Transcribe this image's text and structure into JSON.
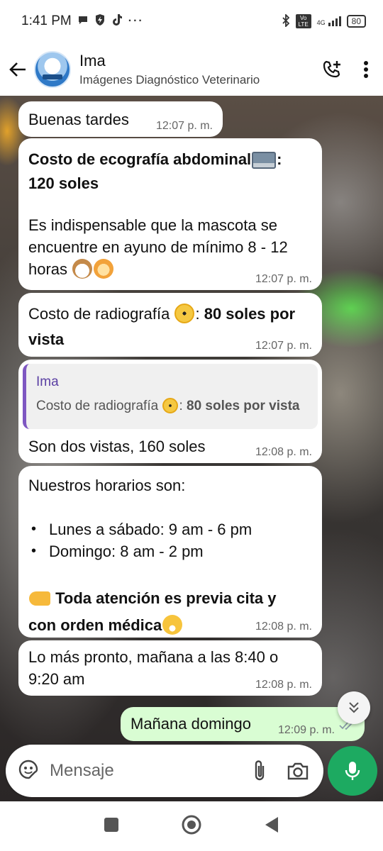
{
  "status_bar": {
    "time": "1:41 PM",
    "icons_left": [
      "chat-bubble-icon",
      "shield-bolt-icon",
      "tiktok-icon",
      "more-dots-icon"
    ],
    "icons_right": [
      "bluetooth-icon",
      "volte-icon",
      "4g-signal-icon"
    ],
    "network": "4G",
    "volte": "Vo LTE",
    "battery": "80"
  },
  "header": {
    "name": "Ima",
    "subtitle": "Imágenes Diagnóstico Veterinario"
  },
  "messages": [
    {
      "text": "Buenas tardes",
      "time": "12:07 p. m."
    },
    {
      "line1": "Costo de ecografía abdominal",
      "line1_tail": ":",
      "line2": "120 soles",
      "para": "Es indispensable que la mascota se encuentre en ayuno de mínimo 8 - 12 horas",
      "time": "12:07 p. m."
    },
    {
      "normal": "Costo de radiografía ",
      "colon": ": ",
      "bold": "80 soles por vista",
      "time": "12:07 p. m."
    },
    {
      "quote_author": "Ima",
      "quote_normal": "Costo de radiografía ",
      "quote_bold": "80 soles por vista",
      "text": "Son dos vistas, 160 soles",
      "time": "12:08 p. m."
    },
    {
      "intro": "Nuestros horarios son:",
      "items": [
        "Lunes a sábado: 9 am - 6 pm",
        "Domingo: 8 am - 2 pm"
      ],
      "note_line1": "Toda atención es previa cita y",
      "note_line2": "con orden médica",
      "time": "12:08 p. m."
    },
    {
      "text": "Lo más pronto, mañana a las 8:40 o 9:20 am",
      "time": "12:08 p. m."
    },
    {
      "text": "Mañana domingo",
      "time": "12:09 p. m.",
      "status": "read"
    }
  ],
  "input": {
    "placeholder": "Mensaje"
  },
  "colors": {
    "accent": "#1daa61",
    "outgoing_bubble": "#d9fdd3",
    "quote_bar": "#7e57c2"
  }
}
